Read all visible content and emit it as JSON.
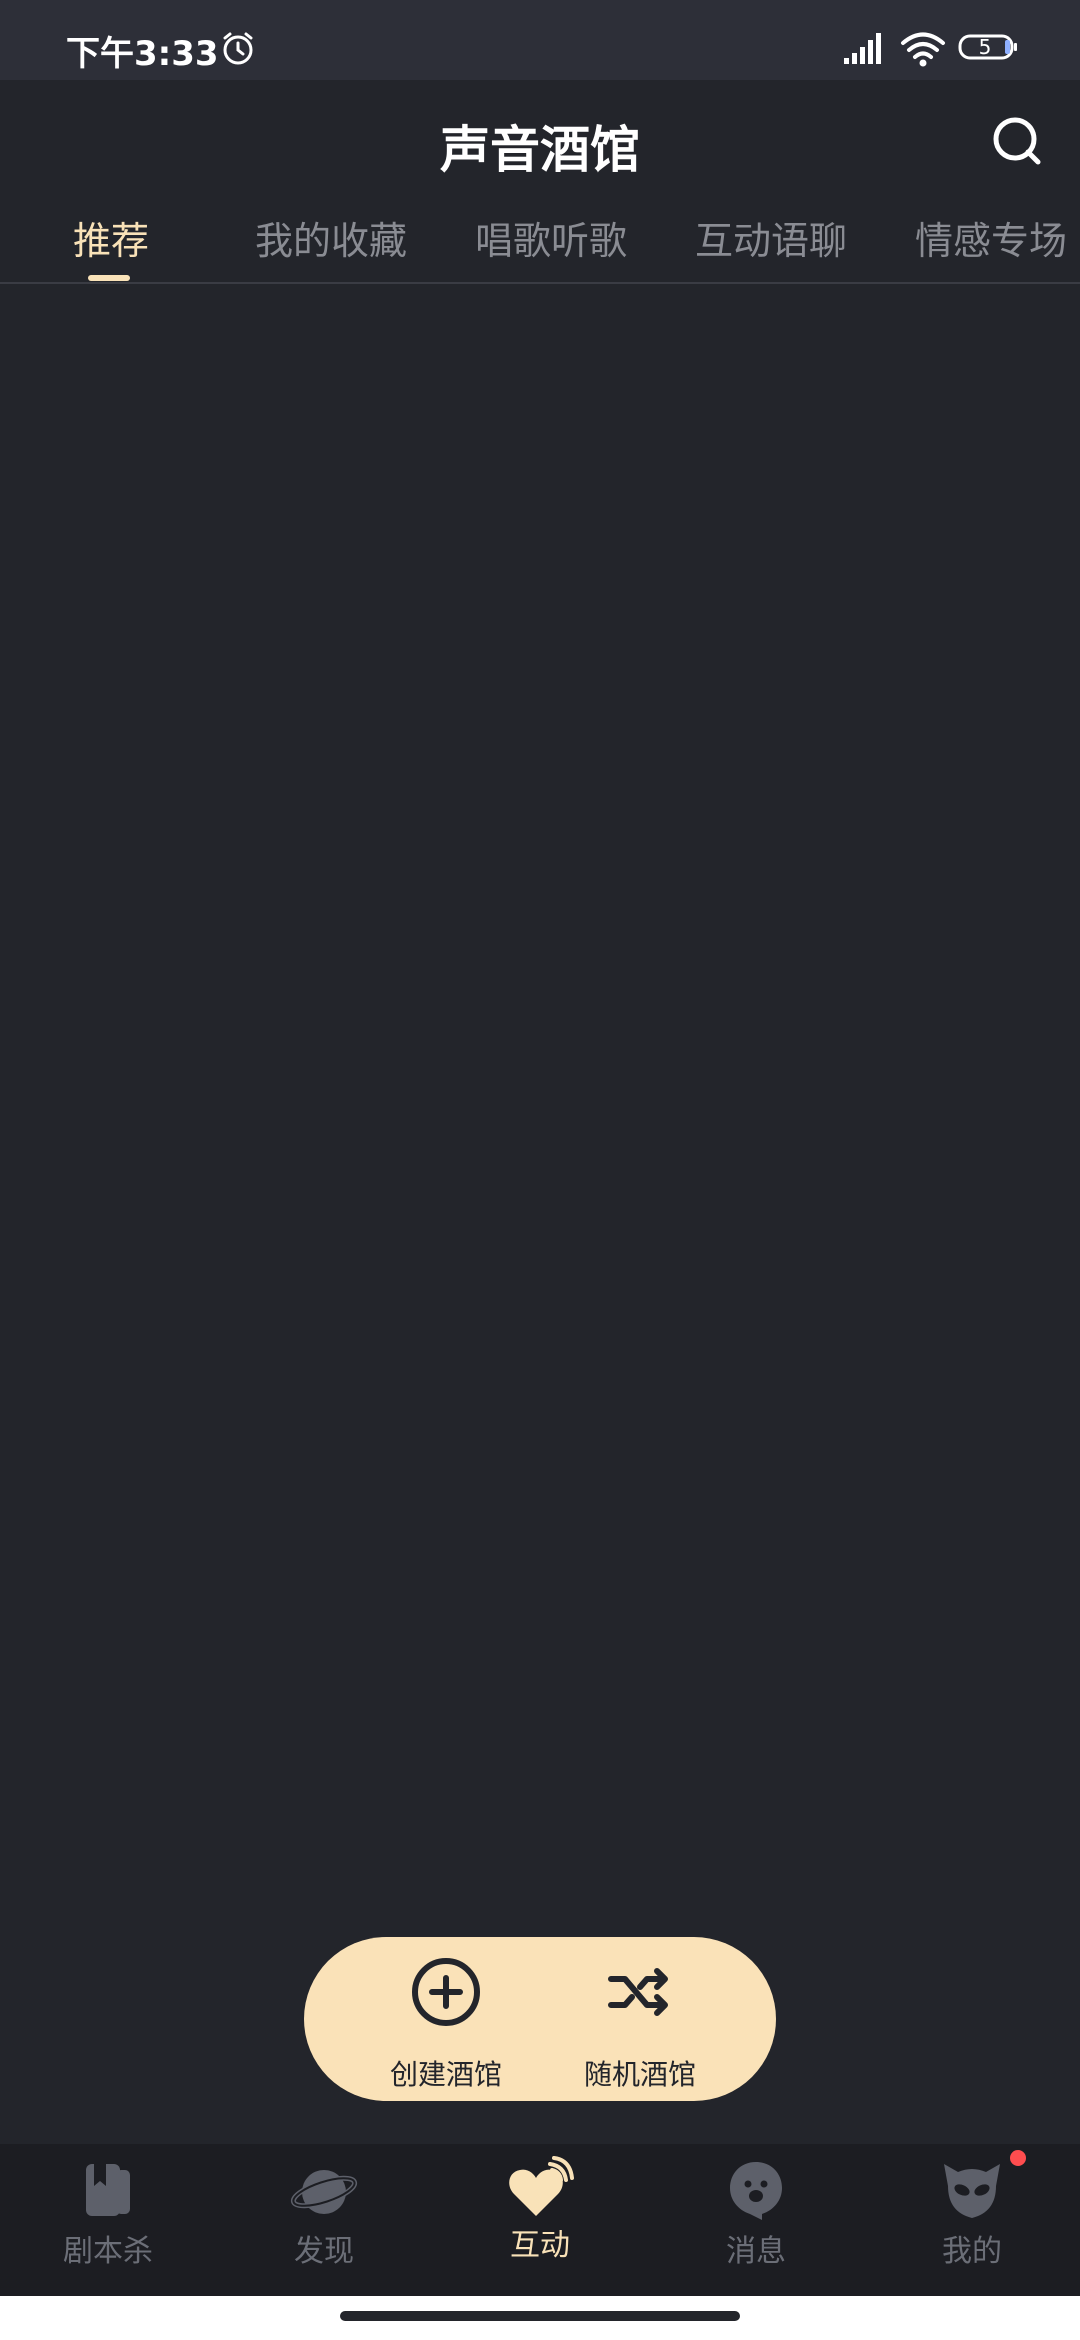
{
  "status_bar": {
    "time": "下午3:33",
    "battery": "5",
    "icons": [
      "alarm-icon",
      "signal-icon",
      "wifi-icon",
      "battery-icon"
    ]
  },
  "header": {
    "title": "声音酒馆",
    "search_icon": "search-icon"
  },
  "tabs": [
    {
      "label": "推荐",
      "active": true
    },
    {
      "label": "我的收藏",
      "active": false
    },
    {
      "label": "唱歌听歌",
      "active": false
    },
    {
      "label": "互动语聊",
      "active": false
    },
    {
      "label": "情感专场",
      "active": false
    }
  ],
  "actions": {
    "create": {
      "label": "创建酒馆",
      "icon": "plus-circle-icon"
    },
    "random": {
      "label": "随机酒馆",
      "icon": "shuffle-icon"
    }
  },
  "bottom_nav": [
    {
      "label": "剧本杀",
      "icon": "book-icon",
      "active": false
    },
    {
      "label": "发现",
      "icon": "planet-icon",
      "active": false
    },
    {
      "label": "互动",
      "icon": "heart-signal-icon",
      "active": true
    },
    {
      "label": "消息",
      "icon": "chat-ghost-icon",
      "active": false
    },
    {
      "label": "我的",
      "icon": "alien-face-icon",
      "active": false,
      "badge": true
    }
  ],
  "colors": {
    "background": "#23252b",
    "accent": "#f9e2b8",
    "tab_inactive": "#8a8c93",
    "nav_inactive": "#6b6e77",
    "badge": "#ff4d4f"
  }
}
